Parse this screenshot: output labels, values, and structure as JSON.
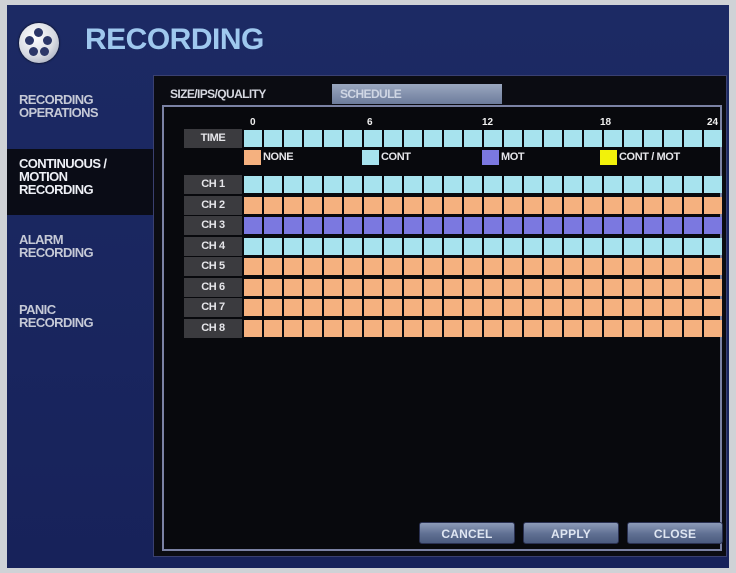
{
  "header": {
    "title": "RECORDING",
    "logo_icon": "film-reel-icon"
  },
  "sidebar": {
    "items": [
      {
        "label": "RECORDING\nOPERATIONS",
        "active": false
      },
      {
        "label": "CONTINUOUS /\nMOTION\nRECORDING",
        "active": true
      },
      {
        "label": "ALARM\nRECORDING",
        "active": false
      },
      {
        "label": "PANIC\nRECORDING",
        "active": false
      }
    ]
  },
  "tabs": [
    {
      "label": "SIZE/IPS/QUALITY",
      "selected": false
    },
    {
      "label": "SCHEDULE",
      "selected": true
    }
  ],
  "schedule": {
    "hour_labels": [
      "0",
      "6",
      "12",
      "18",
      "24"
    ],
    "time_label": "TIME",
    "legend": [
      {
        "label": "NONE",
        "key": "none",
        "color": "#f5b17f"
      },
      {
        "label": "CONT",
        "key": "cont",
        "color": "#a7e3ee"
      },
      {
        "label": "MOT",
        "key": "mot",
        "color": "#7b78e0"
      },
      {
        "label": "CONT / MOT",
        "key": "contmot",
        "color": "#f2f20a"
      }
    ],
    "time_row_mode": "cont",
    "channels": [
      {
        "label": "CH 1",
        "mode": "cont"
      },
      {
        "label": "CH 2",
        "mode": "none"
      },
      {
        "label": "CH 3",
        "mode": "mot"
      },
      {
        "label": "CH 4",
        "mode": "cont"
      },
      {
        "label": "CH 5",
        "mode": "none"
      },
      {
        "label": "CH 6",
        "mode": "none"
      },
      {
        "label": "CH 7",
        "mode": "none"
      },
      {
        "label": "CH 8",
        "mode": "none"
      }
    ]
  },
  "buttons": {
    "cancel": "CANCEL",
    "apply": "APPLY",
    "close": "CLOSE"
  }
}
